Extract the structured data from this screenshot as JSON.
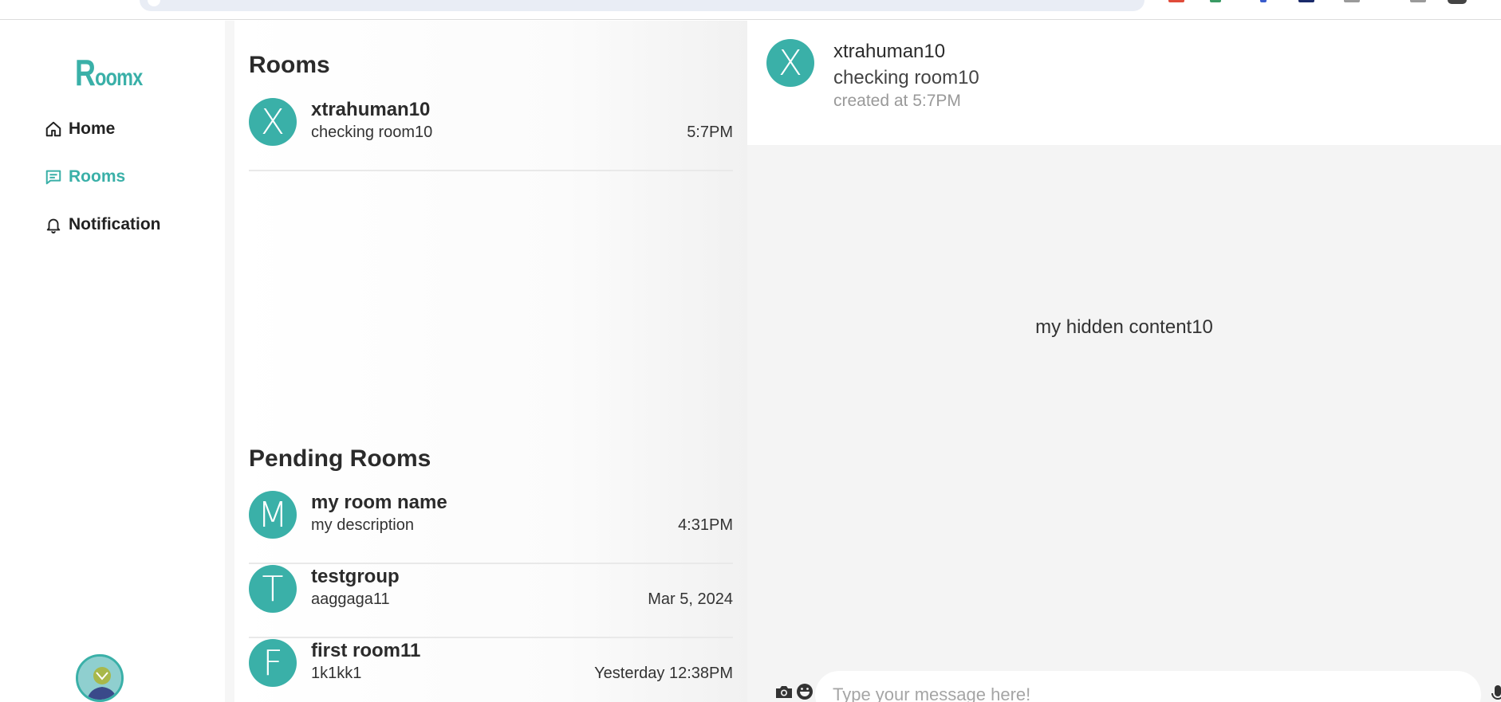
{
  "app": {
    "logo_text": "Roomx",
    "accent": "#3ab0a8"
  },
  "sidebar": {
    "items": [
      {
        "label": "Home",
        "icon": "home-icon",
        "active": false
      },
      {
        "label": "Rooms",
        "icon": "chat-icon",
        "active": true
      },
      {
        "label": "Notification",
        "icon": "bell-icon",
        "active": false
      }
    ]
  },
  "rooms_section": {
    "title": "Rooms",
    "items": [
      {
        "initial": "X",
        "name": "xtrahuman10",
        "description": "checking room10",
        "time": "5:7PM"
      }
    ]
  },
  "pending_section": {
    "title": "Pending Rooms",
    "items": [
      {
        "initial": "M",
        "name": "my room name",
        "description": "my description",
        "time": "4:31PM"
      },
      {
        "initial": "T",
        "name": "testgroup",
        "description": "aaggaga11",
        "time": "Mar 5, 2024"
      },
      {
        "initial": "F",
        "name": "first room11",
        "description": "1k1kk1",
        "time": "Yesterday 12:38PM"
      }
    ]
  },
  "chat": {
    "initial": "X",
    "title": "xtrahuman10",
    "subtitle": "checking room10",
    "created": "created at 5:7PM",
    "hidden_content": "my hidden content10",
    "input_placeholder": "Type your message here!"
  }
}
